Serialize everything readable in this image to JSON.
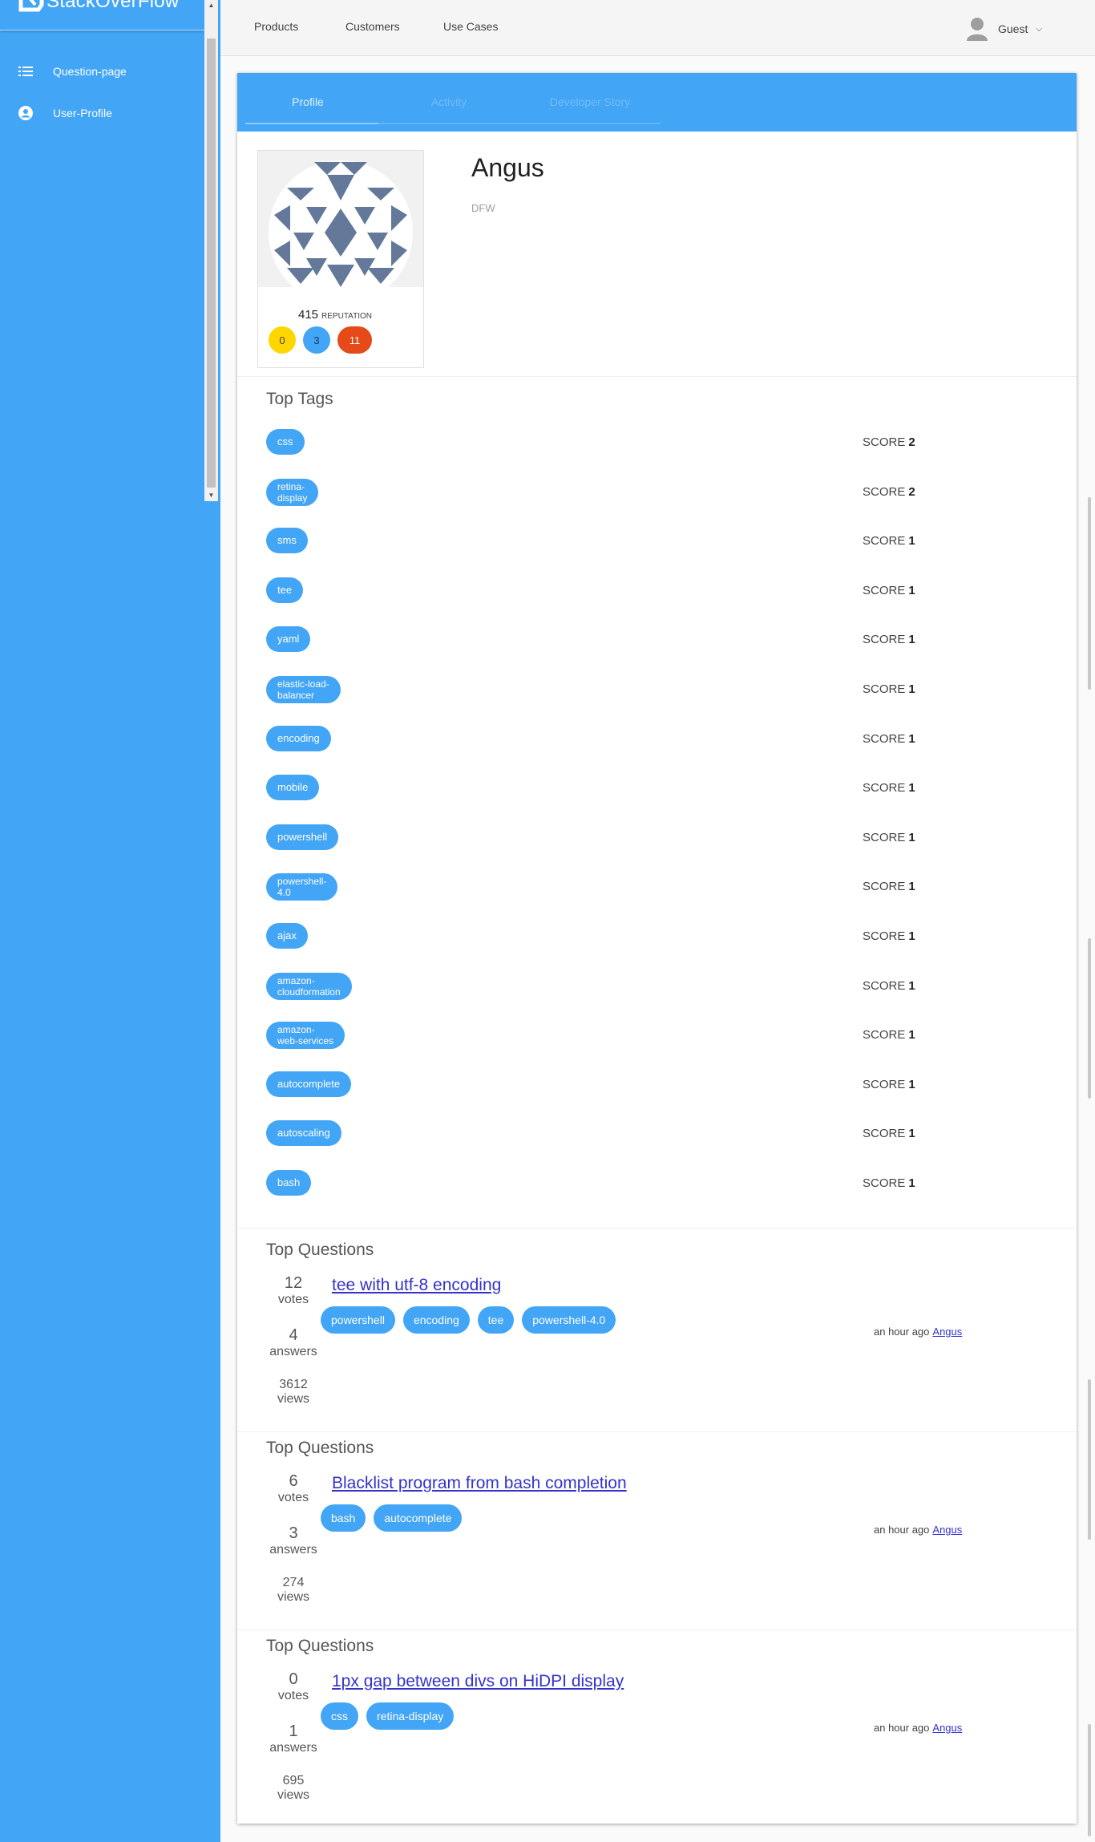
{
  "brand": {
    "name": "StackOverFlow"
  },
  "sidebar": {
    "items": [
      {
        "label": "Question-page",
        "icon": "list-icon"
      },
      {
        "label": "User-Profile",
        "icon": "account-circle-icon"
      }
    ]
  },
  "topnav": {
    "links": [
      "Products",
      "Customers",
      "Use Cases"
    ],
    "user_label": "Guest"
  },
  "tabs": [
    "Profile",
    "Activity",
    "Developer Story"
  ],
  "profile": {
    "name": "Angus",
    "location": "DFW",
    "reputation": "415",
    "reputation_label": "REPUTATION",
    "badges": {
      "gold": "0",
      "silver": "3",
      "bronze": "11"
    }
  },
  "colors": {
    "primary": "#42a5f5",
    "gold": "#ffd600",
    "silver": "#42a5f5",
    "bronze": "#e64a19",
    "link": "#3333cc"
  },
  "top_tags": {
    "title": "Top Tags",
    "score_label": "SCORE",
    "items": [
      {
        "line1": "css",
        "line2": "",
        "score": "2"
      },
      {
        "line1": "retina-",
        "line2": "display",
        "score": "2"
      },
      {
        "line1": "sms",
        "line2": "",
        "score": "1"
      },
      {
        "line1": "tee",
        "line2": "",
        "score": "1"
      },
      {
        "line1": "yaml",
        "line2": "",
        "score": "1"
      },
      {
        "line1": "elastic-load-",
        "line2": "balancer",
        "score": "1"
      },
      {
        "line1": "encoding",
        "line2": "",
        "score": "1"
      },
      {
        "line1": "mobile",
        "line2": "",
        "score": "1"
      },
      {
        "line1": "powershell",
        "line2": "",
        "score": "1"
      },
      {
        "line1": "powershell-",
        "line2": "4.0",
        "score": "1"
      },
      {
        "line1": "ajax",
        "line2": "",
        "score": "1"
      },
      {
        "line1": "amazon-",
        "line2": "cloudformation",
        "score": "1"
      },
      {
        "line1": "amazon-",
        "line2": "web-services",
        "score": "1"
      },
      {
        "line1": "autocomplete",
        "line2": "",
        "score": "1"
      },
      {
        "line1": "autoscaling",
        "line2": "",
        "score": "1"
      },
      {
        "line1": "bash",
        "line2": "",
        "score": "1"
      }
    ]
  },
  "top_questions": {
    "title": "Top Questions",
    "votes_label": "votes",
    "answers_label": "answers",
    "views_label": "views",
    "time_label": "an hour ago",
    "items": [
      {
        "title": "tee with utf-8 encoding",
        "votes": "12",
        "answers": "4",
        "views": "3612",
        "tags": [
          "powershell",
          "encoding",
          "tee",
          "powershell-4.0"
        ],
        "author": "Angus"
      },
      {
        "title": "Blacklist program from bash completion",
        "votes": "6",
        "answers": "3",
        "views": "274",
        "tags": [
          "bash",
          "autocomplete"
        ],
        "author": "Angus"
      },
      {
        "title": "1px gap between divs on HiDPI display",
        "votes": "0",
        "answers": "1",
        "views": "695",
        "tags": [
          "css",
          "retina-display"
        ],
        "author": "Angus"
      }
    ]
  }
}
